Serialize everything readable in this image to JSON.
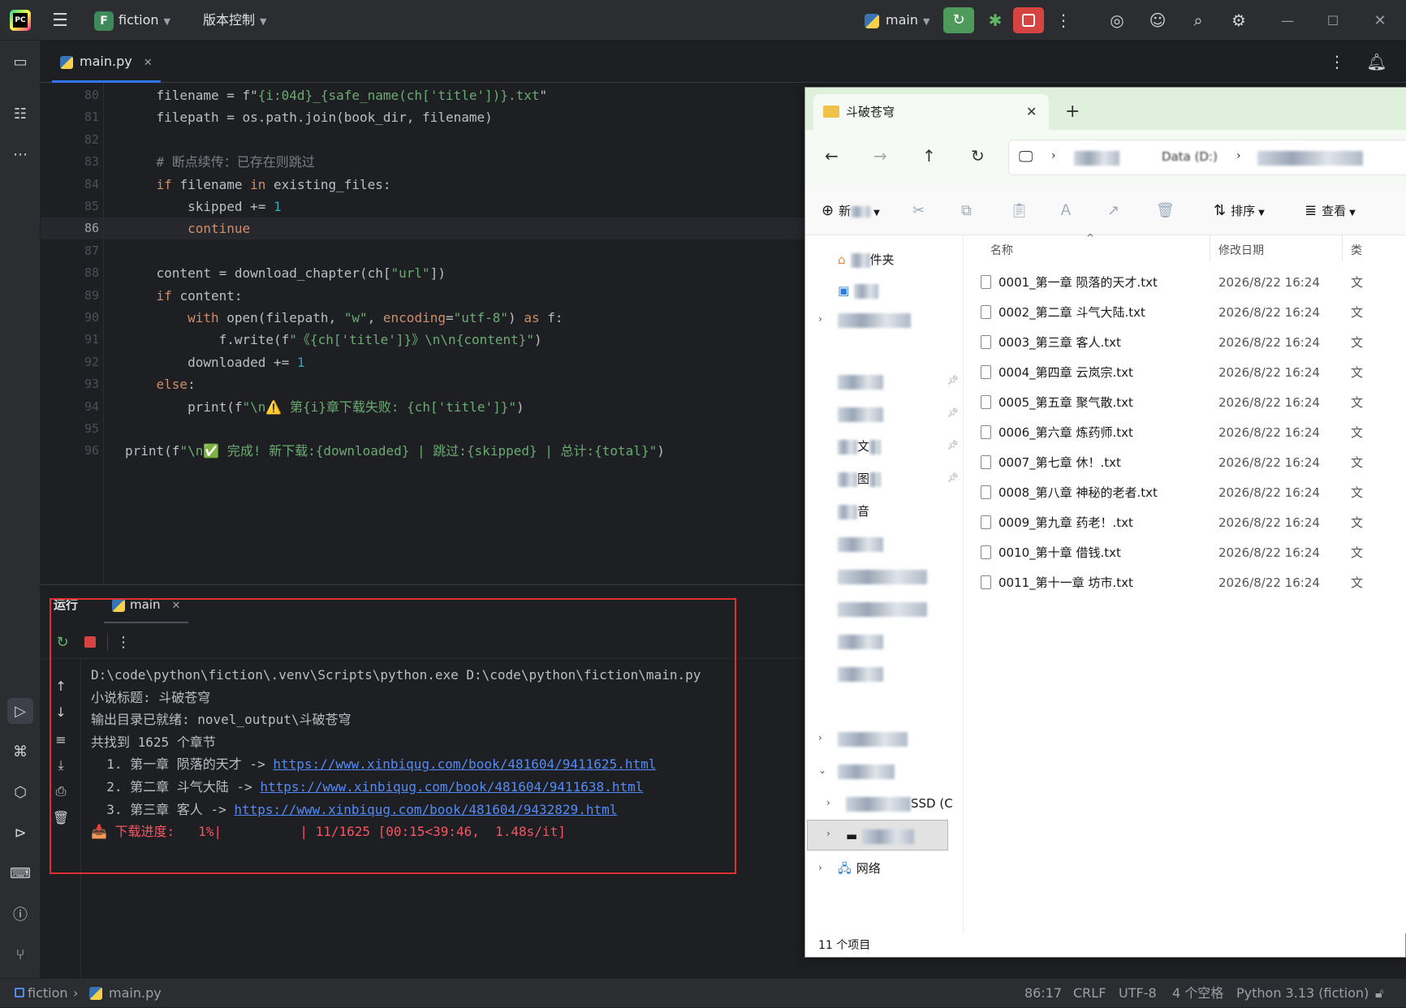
{
  "titlebar": {
    "project_name": "fiction",
    "project_initial": "F",
    "vcs_label": "版本控制",
    "branch": "main"
  },
  "editor": {
    "tab_label": "main.py",
    "lines": [
      {
        "n": "80",
        "parts": [
          [
            "",
            "    filename = f\""
          ],
          [
            "str",
            "{i:04d}_{safe_name(ch['title'])}.txt"
          ],
          [
            "",
            "\""
          ]
        ]
      },
      {
        "n": "81",
        "parts": [
          [
            "",
            "    filepath = os.path.join(book_dir, filename)"
          ]
        ]
      },
      {
        "n": "82",
        "parts": [
          [
            "",
            ""
          ]
        ]
      },
      {
        "n": "83",
        "parts": [
          [
            "cm",
            "    # 断点续传：已存在则跳过"
          ]
        ]
      },
      {
        "n": "84",
        "parts": [
          [
            "kw",
            "    if "
          ],
          [
            "",
            "filename "
          ],
          [
            "kw",
            "in "
          ],
          [
            "",
            "existing_files:"
          ]
        ]
      },
      {
        "n": "85",
        "parts": [
          [
            "",
            "        skipped += "
          ],
          [
            "num",
            "1"
          ]
        ]
      },
      {
        "n": "86",
        "parts": [
          [
            "kw",
            "        continue"
          ]
        ]
      },
      {
        "n": "87",
        "parts": [
          [
            "",
            ""
          ]
        ]
      },
      {
        "n": "88",
        "parts": [
          [
            "",
            "    content = download_chapter(ch["
          ],
          [
            "str",
            "\"url\""
          ],
          [
            "",
            "])"
          ]
        ]
      },
      {
        "n": "89",
        "parts": [
          [
            "kw",
            "    if "
          ],
          [
            "",
            "content:"
          ]
        ]
      },
      {
        "n": "90",
        "parts": [
          [
            "kw",
            "        with "
          ],
          [
            "",
            "open(filepath, "
          ],
          [
            "str",
            "\"w\""
          ],
          [
            "",
            ", "
          ],
          [
            "param",
            "encoding"
          ],
          [
            "",
            "="
          ],
          [
            "str",
            "\"utf-8\""
          ],
          [
            "",
            ") "
          ],
          [
            "kw",
            "as "
          ],
          [
            "",
            "f:"
          ]
        ]
      },
      {
        "n": "91",
        "parts": [
          [
            "",
            "            f.write(f"
          ],
          [
            "str",
            "\"《{ch['title']}》\\n\\n{content}\""
          ],
          [
            "",
            ")"
          ]
        ]
      },
      {
        "n": "92",
        "parts": [
          [
            "",
            "        downloaded += "
          ],
          [
            "num",
            "1"
          ]
        ]
      },
      {
        "n": "93",
        "parts": [
          [
            "kw",
            "    else"
          ],
          [
            "",
            ":"
          ]
        ]
      },
      {
        "n": "94",
        "parts": [
          [
            "",
            "        print(f"
          ],
          [
            "str",
            "\"\\n⚠️ 第{i}章下载失败: {ch['title']}\""
          ],
          [
            "",
            ")"
          ]
        ]
      },
      {
        "n": "95",
        "parts": [
          [
            "",
            ""
          ]
        ]
      },
      {
        "n": "96",
        "parts": [
          [
            "",
            "print(f"
          ],
          [
            "str",
            "\"\\n✅ 完成! 新下载:{downloaded} | 跳过:{skipped} | 总计:{total}\""
          ],
          [
            "",
            ")"
          ]
        ]
      }
    ]
  },
  "run_panel": {
    "label": "运行",
    "tab_label": "main",
    "console": [
      {
        "text": "D:\\code\\python\\fiction\\.venv\\Scripts\\python.exe D:\\code\\python\\fiction\\main.py"
      },
      {
        "text": "小说标题: 斗破苍穹"
      },
      {
        "text": "输出目录已就绪: novel_output\\斗破苍穹"
      },
      {
        "text": "共找到 1625 个章节"
      },
      {
        "prefix": "  1. 第一章 陨落的天才 -> ",
        "link": "https://www.xinbiqug.com/book/481604/9411625.html"
      },
      {
        "prefix": "  2. 第二章 斗气大陆 -> ",
        "link": "https://www.xinbiqug.com/book/481604/9411638.html"
      },
      {
        "prefix": "  3. 第三章 客人 -> ",
        "link": "https://www.xinbiqug.com/book/481604/9432829.html"
      },
      {
        "err": "📥 下载进度:   1%|          | 11/1625 [00:15<39:46,  1.48s/it]"
      }
    ]
  },
  "statusbar": {
    "project": "fiction",
    "file": "main.py",
    "position": "86:17",
    "line_sep": "CRLF",
    "encoding": "UTF-8",
    "indent": "4 个空格",
    "interpreter": "Python 3.13 (fiction)"
  },
  "explorer": {
    "tab_title": "斗破苍穹",
    "address_visible": "Data (D:)",
    "new_label": "新",
    "sort_label": "排序",
    "view_label": "查看",
    "col_name": "名称",
    "col_date": "修改日期",
    "col_type": "类",
    "side_folder_suffix": "件夹",
    "side_labels": [
      "文",
      "图",
      "音",
      "网络"
    ],
    "side_drive_suffix": "SSD (C",
    "files": [
      {
        "name": "0001_第一章 陨落的天才.txt",
        "date": "2026/8/22 16:24",
        "type": "文"
      },
      {
        "name": "0002_第二章 斗气大陆.txt",
        "date": "2026/8/22 16:24",
        "type": "文"
      },
      {
        "name": "0003_第三章 客人.txt",
        "date": "2026/8/22 16:24",
        "type": "文"
      },
      {
        "name": "0004_第四章 云岚宗.txt",
        "date": "2026/8/22 16:24",
        "type": "文"
      },
      {
        "name": "0005_第五章 聚气散.txt",
        "date": "2026/8/22 16:24",
        "type": "文"
      },
      {
        "name": "0006_第六章 炼药师.txt",
        "date": "2026/8/22 16:24",
        "type": "文"
      },
      {
        "name": "0007_第七章 休！.txt",
        "date": "2026/8/22 16:24",
        "type": "文"
      },
      {
        "name": "0008_第八章 神秘的老者.txt",
        "date": "2026/8/22 16:24",
        "type": "文"
      },
      {
        "name": "0009_第九章 药老！.txt",
        "date": "2026/8/22 16:24",
        "type": "文"
      },
      {
        "name": "0010_第十章 借钱.txt",
        "date": "2026/8/22 16:24",
        "type": "文"
      },
      {
        "name": "0011_第十一章 坊市.txt",
        "date": "2026/8/22 16:24",
        "type": "文"
      }
    ],
    "status": "11 个项目"
  }
}
